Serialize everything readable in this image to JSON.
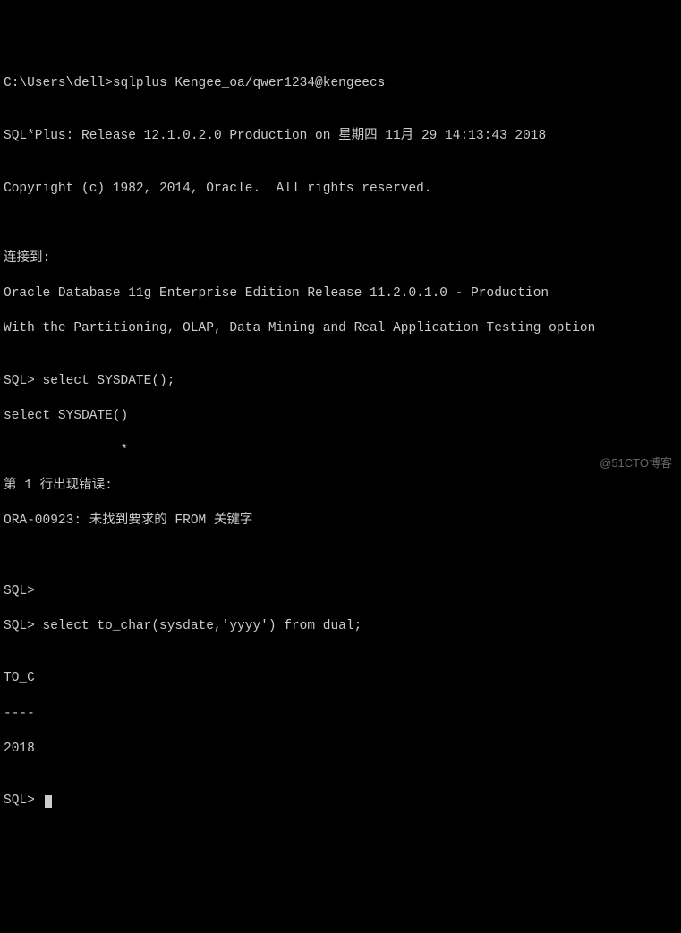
{
  "terminal": {
    "prompt_cmd": "C:\\Users\\dell>sqlplus Kengee_oa/qwer1234@kengeecs",
    "blank1": "",
    "banner": "SQL*Plus: Release 12.1.0.2.0 Production on 星期四 11月 29 14:13:43 2018",
    "blank2": "",
    "copyright": "Copyright (c) 1982, 2014, Oracle.  All rights reserved.",
    "blank3": "",
    "blank4": "",
    "connected": "连接到:",
    "db1": "Oracle Database 11g Enterprise Edition Release 11.2.0.1.0 - Production",
    "db2": "With the Partitioning, OLAP, Data Mining and Real Application Testing option",
    "blank5": "",
    "sql1": "SQL> select SYSDATE();",
    "echo1": "select SYSDATE()",
    "marker": "               *",
    "errline": "第 1 行出现错误:",
    "ora": "ORA-00923: 未找到要求的 FROM 关键字",
    "blank6": "",
    "blank7": "",
    "sql2": "SQL>",
    "sql3": "SQL> select to_char(sysdate,'yyyy') from dual;",
    "blank8": "",
    "col": "TO_C",
    "sep": "----",
    "val": "2018",
    "blank9": "",
    "sqlend": "SQL> "
  },
  "watermark": "@51CTO博客"
}
